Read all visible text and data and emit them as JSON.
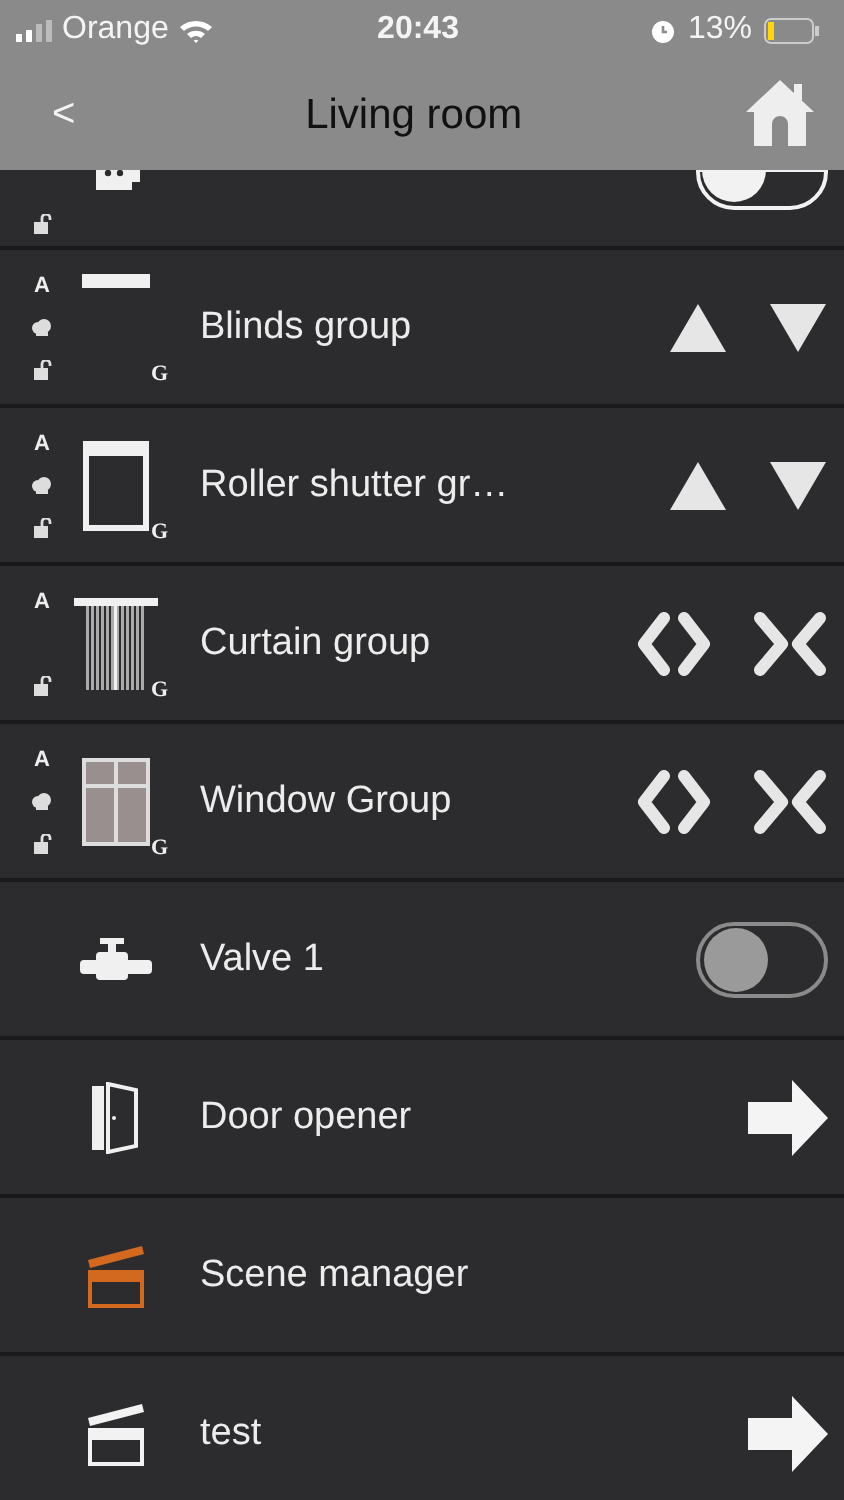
{
  "status_bar": {
    "carrier": "Orange",
    "time": "20:43",
    "battery": "13%"
  },
  "nav": {
    "back": "<",
    "title": "Living room"
  },
  "partial_row": {
    "kind": "socket",
    "on": false,
    "disabled": false,
    "marks": {
      "lock": true
    }
  },
  "rows": [
    {
      "label": "Blinds group",
      "kind": "blind",
      "marks": {
        "top": "A",
        "weather": true,
        "lock": true,
        "bottom": "G"
      }
    },
    {
      "label": "Roller shutter gr…",
      "kind": "shutter",
      "marks": {
        "top": "A",
        "weather": true,
        "lock": true,
        "bottom": "G"
      }
    },
    {
      "label": "Curtain group",
      "kind": "curtain",
      "marks": {
        "top": "A",
        "weather": false,
        "lock": true,
        "bottom": "G"
      }
    },
    {
      "label": "Window Group",
      "kind": "window",
      "marks": {
        "top": "A",
        "weather": true,
        "lock": true,
        "bottom": "G"
      }
    },
    {
      "label": "Valve 1",
      "kind": "valve",
      "on": false,
      "disabled": true
    },
    {
      "label": "Door opener",
      "kind": "door"
    },
    {
      "label": "Scene manager",
      "kind": "scene-manager",
      "color": "#d2691e"
    },
    {
      "label": "test",
      "kind": "scene",
      "color": "#f2f2f2"
    }
  ]
}
